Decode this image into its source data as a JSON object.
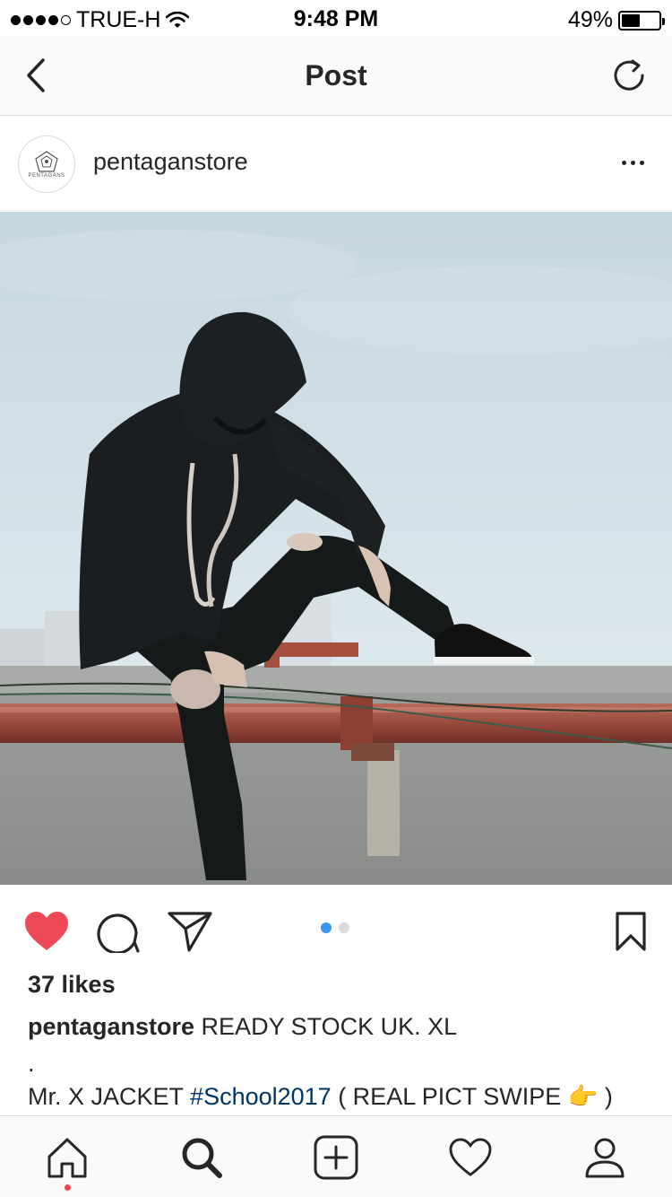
{
  "status_bar": {
    "carrier": "TRUE-H",
    "time": "9:48 PM",
    "battery": "49%",
    "battery_level": 0.49,
    "signal_bars": 4
  },
  "nav": {
    "title": "Post",
    "back_icon": "chevron-left-icon",
    "refresh_icon": "refresh-icon"
  },
  "post": {
    "username": "pentaganstore",
    "avatar_text": "PENTAGANS",
    "more_icon": "more-horizontal-icon",
    "image_alt": "Person in black hoodie sitting on rooftop ledge",
    "carousel_total": 2,
    "carousel_active": 1,
    "liked": true,
    "likes": "37 likes",
    "caption_user": "pentaganstore",
    "caption_text": " READY STOCK UK. XL",
    "caption_dot": ".",
    "caption_line2_pre": "Mr. X JACKET ",
    "caption_hashtag": "#School2017",
    "caption_line2_post": " ( REAL PICT SWIPE 👉  )"
  },
  "tabs": [
    {
      "name": "home-icon",
      "active": true
    },
    {
      "name": "search-icon",
      "active": false
    },
    {
      "name": "add-icon",
      "active": false
    },
    {
      "name": "activity-heart-icon",
      "active": false
    },
    {
      "name": "profile-icon",
      "active": false
    }
  ],
  "colors": {
    "like_red": "#ed4956",
    "carousel_blue": "#3897f0",
    "hashtag_blue": "#003569",
    "text": "#262626",
    "divider": "#dbdbdb"
  }
}
